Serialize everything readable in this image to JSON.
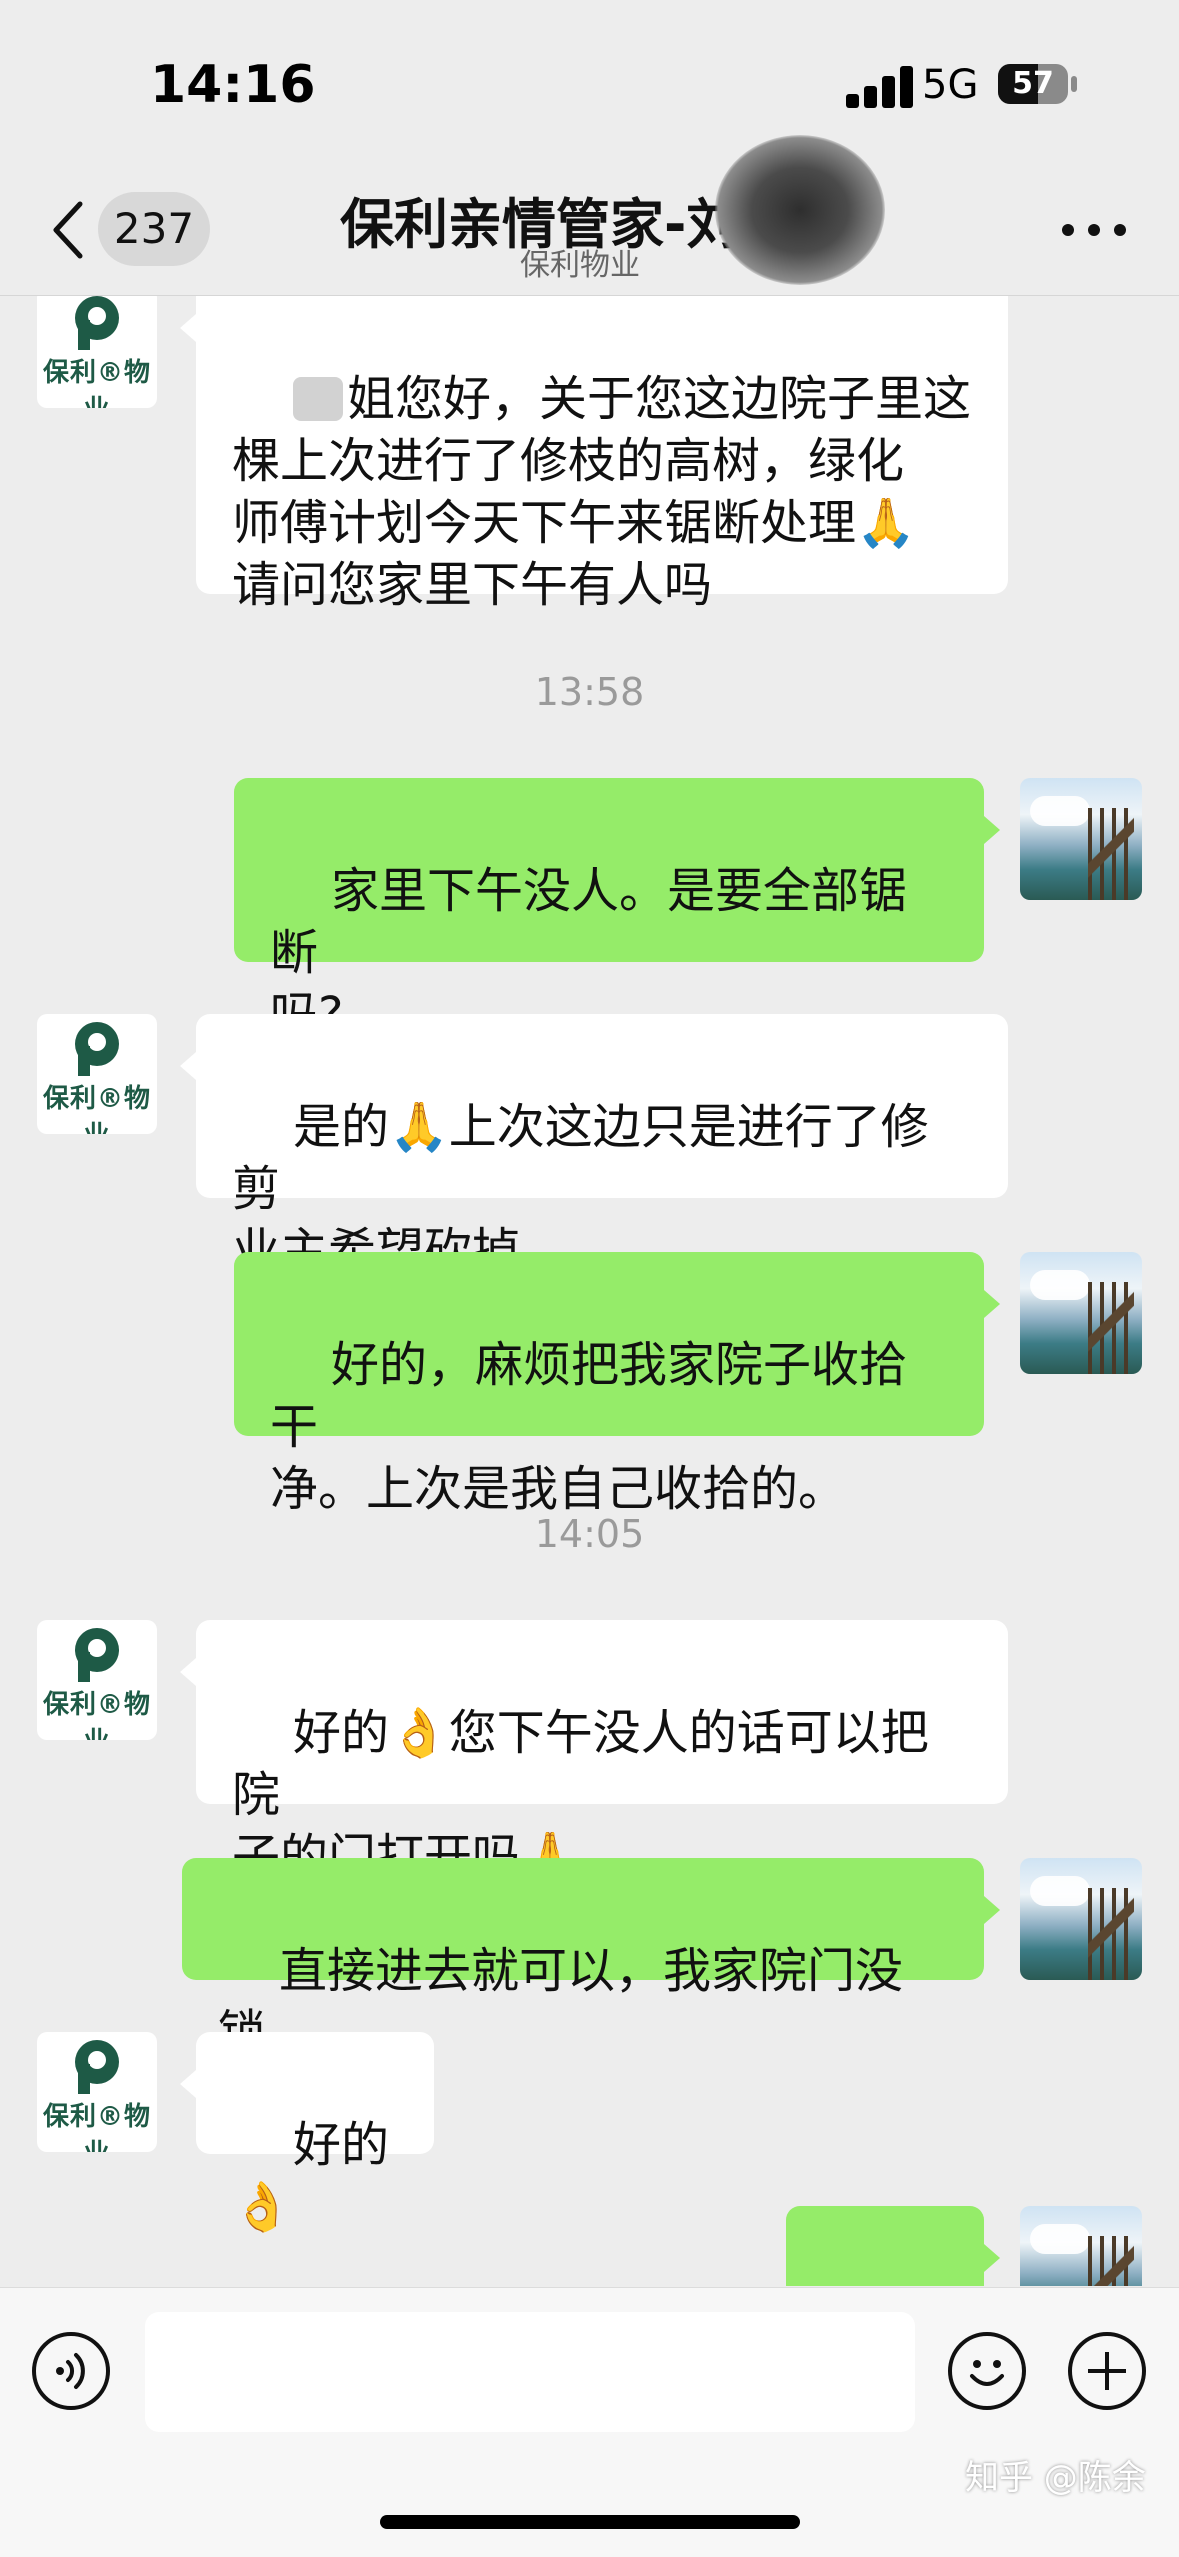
{
  "status_bar": {
    "time": "14:16",
    "network": "5G",
    "battery": "57",
    "battery_level": 0.57
  },
  "nav": {
    "unread_count": "237",
    "title": "保利亲情管家-刘",
    "subtitle": "保利物业",
    "back_icon": "chevron-left-icon",
    "more_icon": "more-dots-icon"
  },
  "avatars": {
    "service_logo_text": "保利®物业"
  },
  "messages": [
    {
      "id": "m1",
      "sender": "service",
      "text": "姐您好，关于您这边院子里这\n棵上次进行了修枝的高树，绿化\n师傅计划今天下午来锯断处理🙏\n请问您家里下午有人吗"
    },
    {
      "id": "t1",
      "type": "time",
      "text": "13:58"
    },
    {
      "id": "m2",
      "sender": "me",
      "text": "家里下午没人。是要全部锯断\n吗?"
    },
    {
      "id": "m3",
      "sender": "service",
      "text": "是的🙏上次这边只是进行了修剪\n业主希望砍掉"
    },
    {
      "id": "m4",
      "sender": "me",
      "text": "好的，麻烦把我家院子收拾干\n净。上次是我自己收拾的。"
    },
    {
      "id": "t2",
      "type": "time",
      "text": "14:05"
    },
    {
      "id": "m5",
      "sender": "service",
      "text": "好的👌您下午没人的话可以把院\n子的门打开吗🙏"
    },
    {
      "id": "m6",
      "sender": "me",
      "text": "直接进去就可以，我家院门没锁"
    },
    {
      "id": "m7",
      "sender": "service",
      "text": "好的👌"
    },
    {
      "id": "m8",
      "sender": "me",
      "text": "🤝🤝"
    }
  ],
  "input_bar": {
    "voice_icon": "voice-icon",
    "emoji_icon": "emoji-icon",
    "plus_icon": "plus-icon"
  },
  "watermark": "知乎 @陈余",
  "colors": {
    "outgoing_bubble": "#95ec69",
    "incoming_bubble": "#ffffff",
    "background": "#ededed",
    "logo_green": "#1e5a46"
  }
}
